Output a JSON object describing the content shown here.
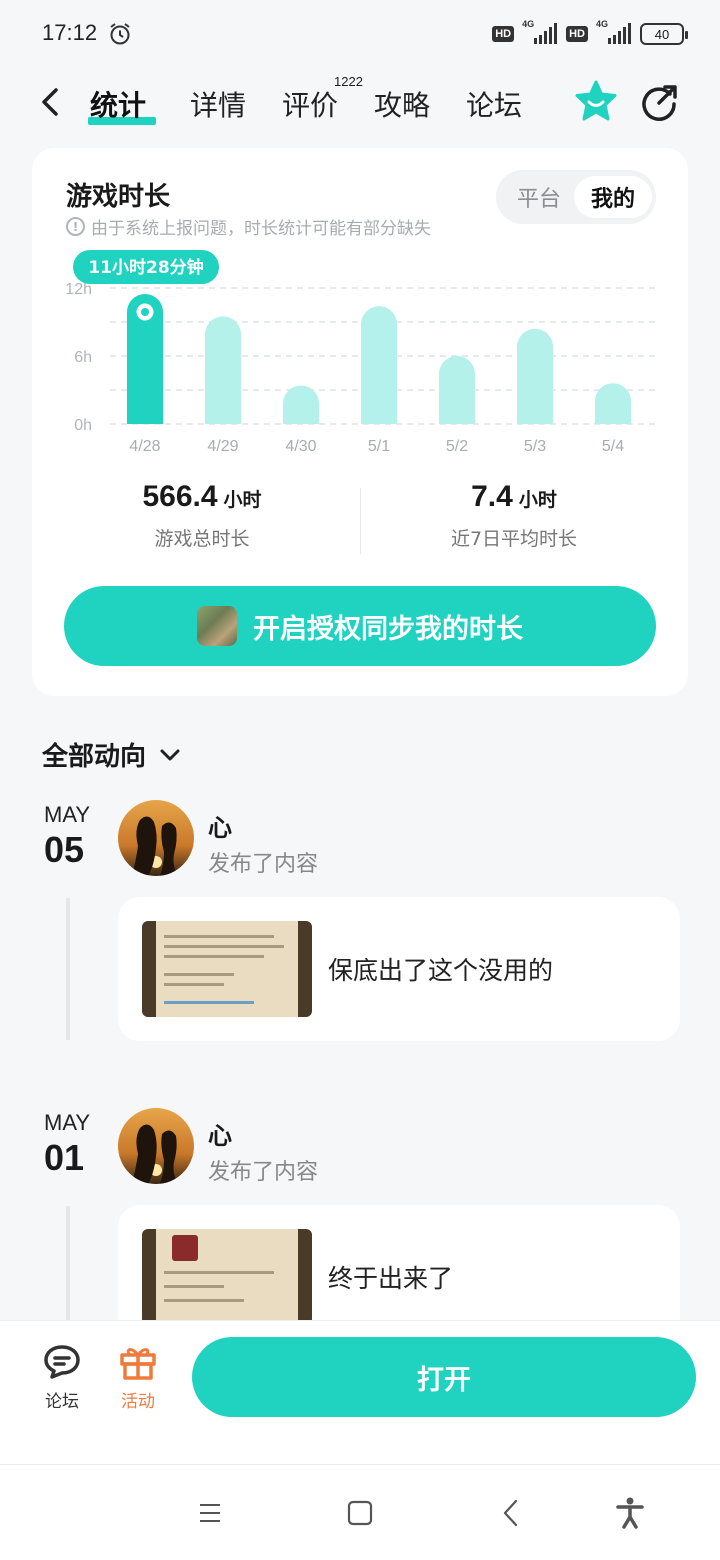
{
  "status_bar": {
    "time": "17:12",
    "battery": "40",
    "net1": "4G",
    "net2": "4G",
    "hd": "HD"
  },
  "nav": {
    "tabs": [
      {
        "label": "统计",
        "active": true
      },
      {
        "label": "详情",
        "active": false
      },
      {
        "label": "评价",
        "active": false,
        "count": "1222"
      },
      {
        "label": "攻略",
        "active": false
      },
      {
        "label": "论坛",
        "active": false
      }
    ]
  },
  "stats_card": {
    "title": "游戏时长",
    "note": "由于系统上报问题，时长统计可能有部分缺失",
    "toggle": {
      "left": "平台",
      "right": "我的",
      "selected": "我的"
    },
    "tooltip": "11小时28分钟",
    "total": {
      "value": "566.4",
      "unit": "小时",
      "label": "游戏总时长"
    },
    "average": {
      "value": "7.4",
      "unit": "小时",
      "label": "近7日平均时长"
    },
    "sync_button": "开启授权同步我的时长"
  },
  "chart_data": {
    "type": "bar",
    "categories": [
      "4/28",
      "4/29",
      "4/30",
      "5/1",
      "5/2",
      "5/3",
      "5/4"
    ],
    "values": [
      11.47,
      9.5,
      3.4,
      10.4,
      6.0,
      8.4,
      3.6
    ],
    "y_ticks": [
      "0h",
      "6h",
      "12h"
    ],
    "ylim": [
      0,
      12
    ],
    "highlight_index": 0,
    "colors": {
      "highlight": "#1fd3c0",
      "normal": "#b3f1ea",
      "grid": "#dfe3e6"
    }
  },
  "feed": {
    "header": "全部动向",
    "items": [
      {
        "month": "MAY",
        "day": "05",
        "user": "心",
        "action": "发布了内容",
        "text": "保底出了这个没用的"
      },
      {
        "month": "MAY",
        "day": "01",
        "user": "心",
        "action": "发布了内容",
        "text": "终于出来了"
      }
    ]
  },
  "bottom_bar": {
    "forum": "论坛",
    "activity": "活动",
    "open": "打开"
  },
  "colors": {
    "accent": "#1fd3c0",
    "activity": "#f07a3c"
  }
}
